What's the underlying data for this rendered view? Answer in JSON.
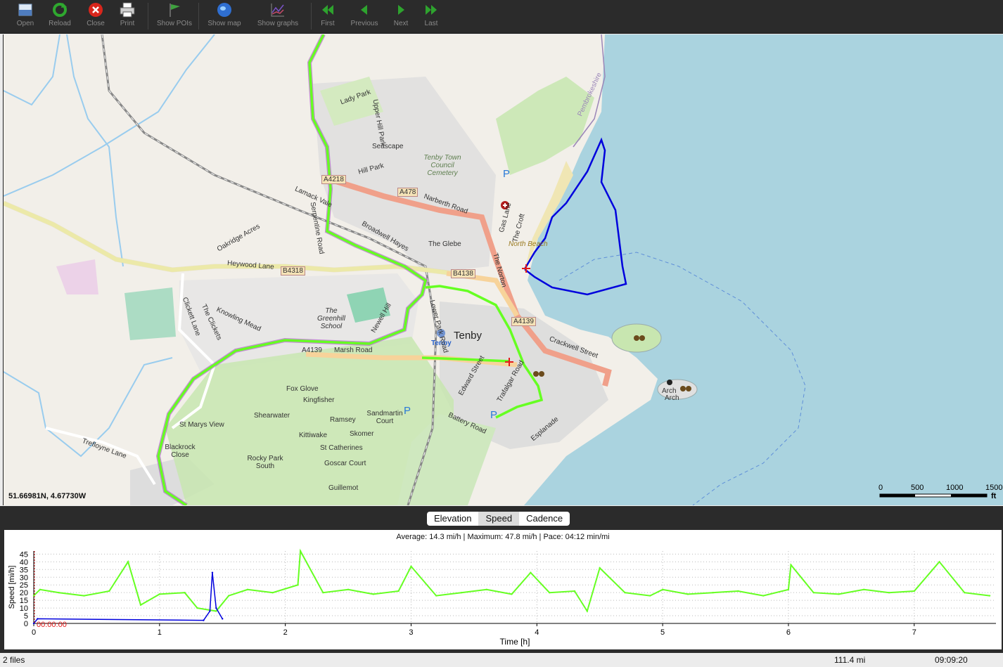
{
  "toolbar": {
    "buttons": [
      {
        "label": "Open",
        "icon": "open-file-icon"
      },
      {
        "label": "Reload",
        "icon": "reload-icon"
      },
      {
        "label": "Close",
        "icon": "close-icon"
      },
      {
        "label": "Print",
        "icon": "print-icon"
      },
      {
        "label": "Show POIs",
        "icon": "flag-icon"
      },
      {
        "label": "Show map",
        "icon": "globe-icon"
      },
      {
        "label": "Show graphs",
        "icon": "graph-icon"
      },
      {
        "label": "First",
        "icon": "first-icon"
      },
      {
        "label": "Previous",
        "icon": "previous-icon"
      },
      {
        "label": "Next",
        "icon": "next-icon"
      },
      {
        "label": "Last",
        "icon": "last-icon"
      }
    ]
  },
  "map": {
    "coordinates": "51.66981N, 4.67730W",
    "labels": {
      "tenby": "Tenby",
      "tenby_station": "Tenby",
      "a4218": "A4218",
      "a478": "A478",
      "narberth_road": "Narberth Road",
      "b4318": "B4318",
      "b4138": "B4138",
      "a4139": "A4139",
      "heywood_lane": "Heywood Lane",
      "oakridge_acres": "Oakridge Acres",
      "lamack_vale": "Lamack Vale",
      "serpentine_road": "Serpentine Road",
      "broadwell_hayes": "Broadwell Hayes",
      "the_glebe": "The Glebe",
      "gas_lane": "Gas Lane",
      "the_croft": "The Croft",
      "the_norton": "The Norton",
      "north_beach": "North Beach",
      "pembrokeshire": "Pembrokeshire",
      "lady_park": "Lady Park",
      "upper_hill_park": "Upper Hill Park",
      "seascape": "Seascape",
      "hill_park": "Hill Park",
      "cemetery": "Tenby Town Council Cemetery",
      "greenhill_school": "The Greenhill School",
      "knowling_mead": "Knowling Mead",
      "the_clickets": "The Clickets",
      "clickett_lane": "Clickett Lane",
      "newell_hill": "Newell Hill",
      "marsh_road": "Marsh Road",
      "a4139_west": "A4139",
      "lower_park_road": "Lower Park Road",
      "fox_glove": "Fox Glove",
      "kingfisher": "Kingfisher",
      "shearwater": "Shearwater",
      "ramsey": "Ramsey",
      "sandmartin_court": "Sandmartin Court",
      "st_marys_view": "St Marys View",
      "kittiwake": "Kittiwake",
      "skomer": "Skomer",
      "st_catherines": "St Catherines",
      "blackrock_close": "Blackrock Close",
      "rocky_park_south": "Rocky Park South",
      "goscar_court": "Goscar Court",
      "guillemot": "Guillemot",
      "trefloyne_lane": "Trefloyne Lane",
      "edward_street": "Edward Street",
      "trafalgar_road": "Trafalgar Road",
      "battery_road": "Battery Road",
      "esplanade": "Esplanade",
      "crackwell_street": "Crackwell Street",
      "arch": "Arch",
      "arch2": "Arch",
      "parking": "P"
    },
    "scale": {
      "ticks": [
        "0",
        "500",
        "1000",
        "1500"
      ],
      "unit": "ft"
    }
  },
  "graph": {
    "tabs": [
      "Elevation",
      "Speed",
      "Cadence"
    ],
    "active_tab": "Speed",
    "stats": "Average: 14.3 mi/h | Maximum: 47.8 mi/h | Pace: 04:12 min/mi",
    "marker_time": "00:00:00"
  },
  "chart_data": {
    "type": "line",
    "title": "",
    "xlabel": "Time [h]",
    "ylabel": "Speed [mi/h]",
    "xlim": [
      0,
      7.65
    ],
    "ylim": [
      0,
      47
    ],
    "x_ticks": [
      "0",
      "1",
      "2",
      "3",
      "4",
      "5",
      "6",
      "7"
    ],
    "y_ticks": [
      "0",
      "5",
      "10",
      "15",
      "20",
      "25",
      "30",
      "35",
      "40",
      "45"
    ],
    "grid": true,
    "series": [
      {
        "color": "#66ff22",
        "description": "speed of file 1 over time",
        "x": [
          0,
          0.05,
          0.2,
          0.4,
          0.6,
          0.75,
          0.85,
          1.0,
          1.2,
          1.3,
          1.45,
          1.55,
          1.7,
          1.9,
          2.1,
          2.12,
          2.3,
          2.5,
          2.7,
          2.9,
          3.0,
          3.2,
          3.4,
          3.6,
          3.8,
          3.95,
          4.1,
          4.3,
          4.4,
          4.5,
          4.7,
          4.9,
          5.0,
          5.2,
          5.4,
          5.6,
          5.8,
          6.0,
          6.02,
          6.2,
          6.4,
          6.6,
          6.8,
          7.0,
          7.2,
          7.4,
          7.6
        ],
        "y": [
          18,
          22,
          20,
          18,
          21,
          40,
          12,
          19,
          20,
          10,
          8,
          18,
          22,
          20,
          25,
          47,
          20,
          22,
          19,
          21,
          37,
          18,
          20,
          22,
          19,
          33,
          20,
          21,
          8,
          36,
          20,
          18,
          22,
          19,
          20,
          21,
          18,
          22,
          38,
          20,
          19,
          22,
          20,
          21,
          40,
          20,
          18
        ]
      },
      {
        "color": "#0000dd",
        "description": "speed of file 2 over time",
        "x": [
          0,
          0.03,
          1.35,
          1.4,
          1.42,
          1.45,
          1.5
        ],
        "y": [
          0,
          3,
          2,
          8,
          33,
          10,
          3
        ]
      }
    ]
  },
  "status": {
    "files": "2 files",
    "distance": "111.4 mi",
    "duration": "09:09:20"
  }
}
